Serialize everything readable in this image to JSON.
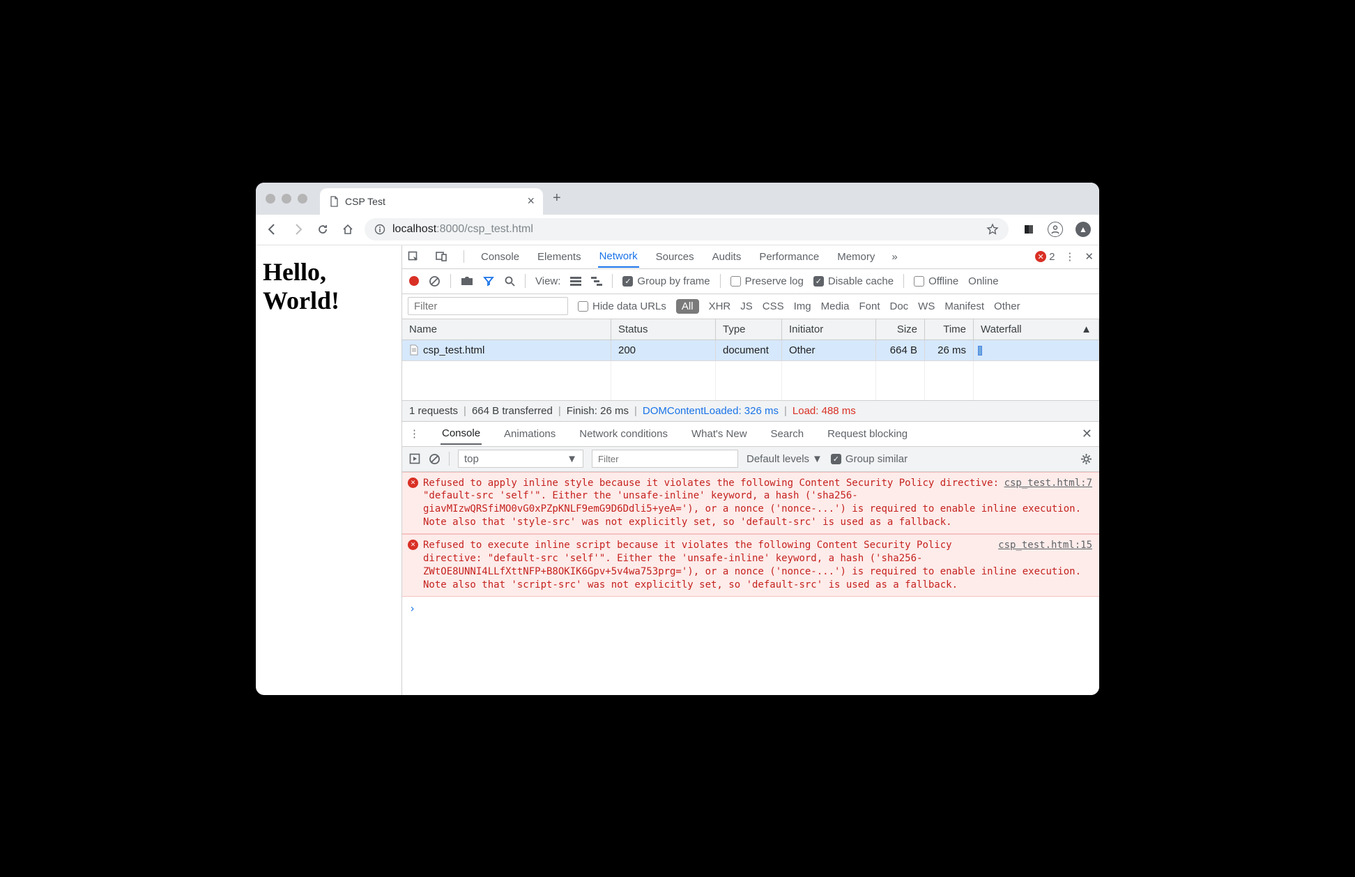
{
  "tab": {
    "title": "CSP Test"
  },
  "nav": {
    "url_host": "localhost",
    "url_port": ":8000",
    "url_path": "/csp_test.html"
  },
  "page": {
    "content": "Hello, World!"
  },
  "devtools": {
    "tabs": [
      "Console",
      "Elements",
      "Network",
      "Sources",
      "Audits",
      "Performance",
      "Memory"
    ],
    "active_tab": "Network",
    "error_count": "2"
  },
  "net_toolbar": {
    "view_label": "View:",
    "group_by_frame": "Group by frame",
    "preserve_log": "Preserve log",
    "disable_cache": "Disable cache",
    "offline": "Offline",
    "online": "Online"
  },
  "net_filter": {
    "placeholder": "Filter",
    "hide_data_urls": "Hide data URLs",
    "types": [
      "All",
      "XHR",
      "JS",
      "CSS",
      "Img",
      "Media",
      "Font",
      "Doc",
      "WS",
      "Manifest",
      "Other"
    ],
    "active_type": "All"
  },
  "net_table": {
    "headers": [
      "Name",
      "Status",
      "Type",
      "Initiator",
      "Size",
      "Time",
      "Waterfall"
    ],
    "rows": [
      {
        "name": "csp_test.html",
        "status": "200",
        "type": "document",
        "initiator": "Other",
        "size": "664 B",
        "time": "26 ms"
      }
    ]
  },
  "net_summary": {
    "requests": "1 requests",
    "transferred": "664 B transferred",
    "finish": "Finish: 26 ms",
    "dcl": "DOMContentLoaded: 326 ms",
    "load": "Load: 488 ms"
  },
  "drawer": {
    "tabs": [
      "Console",
      "Animations",
      "Network conditions",
      "What's New",
      "Search",
      "Request blocking"
    ],
    "active": "Console"
  },
  "console_toolbar": {
    "context": "top",
    "filter_placeholder": "Filter",
    "levels": "Default levels",
    "group_similar": "Group similar"
  },
  "console_messages": [
    {
      "text": "Refused to apply inline style because it violates the following Content Security Policy directive: \"default-src 'self'\". Either the 'unsafe-inline' keyword, a hash ('sha256-giavMIzwQRSfiMO0vG0xPZpKNLF9emG9D6Ddli5+yeA='), or a nonce ('nonce-...') is required to enable inline execution. Note also that 'style-src' was not explicitly set, so 'default-src' is used as a fallback.",
      "source": "csp_test.html:7"
    },
    {
      "text": "Refused to execute inline script because it violates the following Content Security Policy directive: \"default-src 'self'\". Either the 'unsafe-inline' keyword, a hash ('sha256-ZWtOE8UNNI4LLfXttNFP+B8OKIK6Gpv+5v4wa753prg='), or a nonce ('nonce-...') is required to enable inline execution. Note also that 'script-src' was not explicitly set, so 'default-src' is used as a fallback.",
      "source": "csp_test.html:15"
    }
  ]
}
